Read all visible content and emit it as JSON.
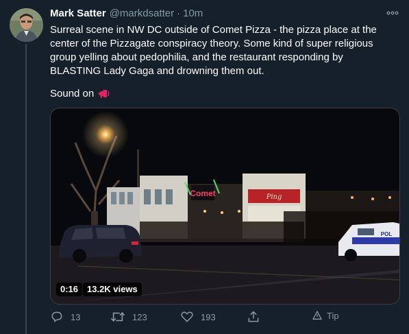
{
  "tweet": {
    "author_name": "Mark Satter",
    "author_handle": "@markdsatter",
    "separator": "·",
    "time": "10m",
    "text": "Surreal scene in NW DC outside of Comet Pizza - the pizza place at the center of the Pizzagate conspiracy theory. Some kind of super religious group yelling about pedophilia, and the restaurant responding by BLASTING Lady Gaga and drowning them out.",
    "sound_text": "Sound on",
    "sound_icon": "megaphone-icon"
  },
  "video": {
    "duration": "0:16",
    "views": "13.2K views",
    "signs": [
      "Comet",
      "Ping",
      "POL"
    ]
  },
  "actions": {
    "reply_count": "13",
    "retweet_count": "123",
    "like_count": "193",
    "tip_label": "Tip"
  },
  "colors": {
    "background": "#15202b",
    "secondary_text": "#8899a6",
    "divider": "#38444d"
  }
}
